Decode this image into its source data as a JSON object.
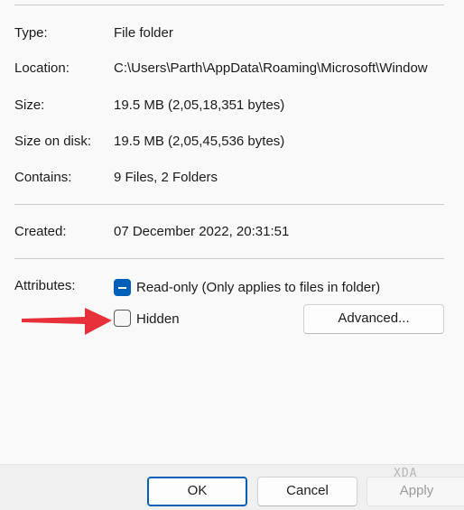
{
  "properties": {
    "type_label": "Type:",
    "type_value": "File folder",
    "location_label": "Location:",
    "location_value": "C:\\Users\\Parth\\AppData\\Roaming\\Microsoft\\Window",
    "size_label": "Size:",
    "size_value": "19.5 MB (2,05,18,351 bytes)",
    "size_on_disk_label": "Size on disk:",
    "size_on_disk_value": "19.5 MB (2,05,45,536 bytes)",
    "contains_label": "Contains:",
    "contains_value": "9 Files, 2 Folders",
    "created_label": "Created:",
    "created_value": "07 December 2022, 20:31:51"
  },
  "attributes": {
    "label": "Attributes:",
    "readonly_label": "Read-only (Only applies to files in folder)",
    "readonly_state": "indeterminate",
    "hidden_label": "Hidden",
    "hidden_checked": false,
    "advanced_button": "Advanced..."
  },
  "footer": {
    "ok_button": "OK",
    "cancel_button": "Cancel",
    "apply_button": "Apply",
    "apply_enabled": false
  },
  "watermark": "XDA",
  "colors": {
    "accent": "#005fb8",
    "arrow": "#e8303a"
  },
  "annotation": {
    "arrow_icon": "red-arrow-pointing-right"
  }
}
